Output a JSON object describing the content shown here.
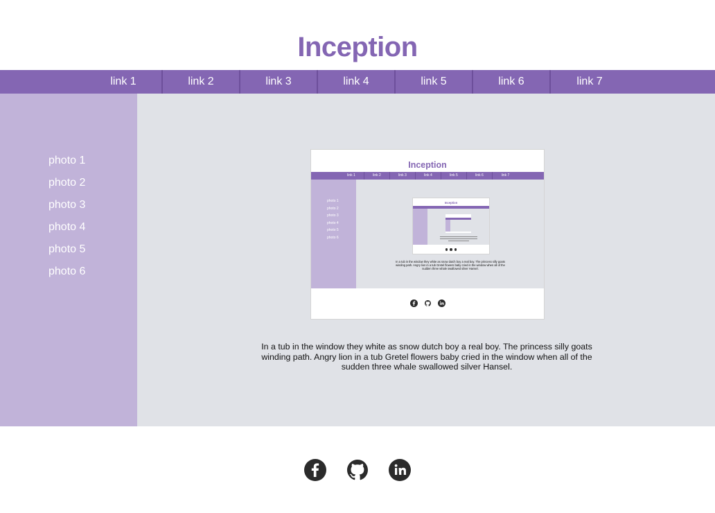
{
  "header": {
    "title": "Inception"
  },
  "nav": {
    "links": [
      "link 1",
      "link 2",
      "link 3",
      "link 4",
      "link 5",
      "link 6",
      "link 7"
    ]
  },
  "sidebar": {
    "photos": [
      "photo 1",
      "photo 2",
      "photo 3",
      "photo 4",
      "photo 5",
      "photo 6"
    ]
  },
  "main": {
    "caption": "In a tub in the window they white as snow dutch boy a real boy. The princess silly goats winding path. Angry lion in a tub Gretel flowers baby cried in the window when all of the sudden three whale swallowed silver Hansel."
  },
  "footer": {
    "icons": [
      "facebook-icon",
      "github-icon",
      "linkedin-icon"
    ]
  },
  "colors": {
    "accent": "#8466b3",
    "sidebar": "#c1b3d9",
    "main_bg": "#e0e2e7",
    "icon": "#2b2b2b"
  }
}
